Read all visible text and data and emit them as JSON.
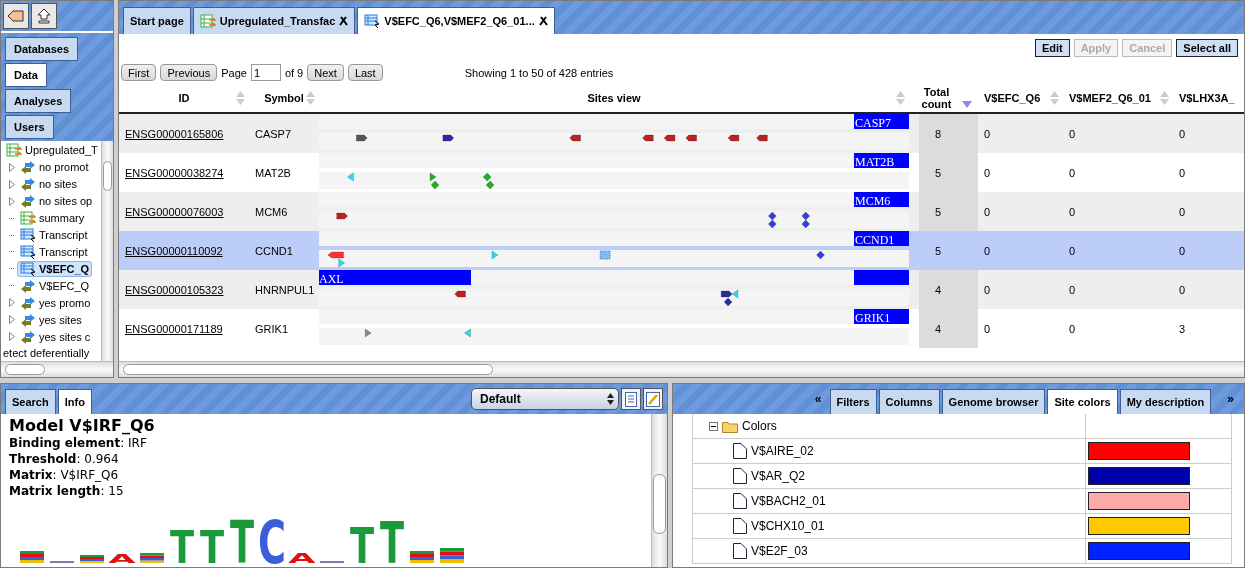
{
  "sidebar": {
    "tabs": [
      {
        "label": "Databases",
        "selected": false
      },
      {
        "label": "Data",
        "selected": true
      },
      {
        "label": "Analyses",
        "selected": false
      },
      {
        "label": "Users",
        "selected": false
      }
    ],
    "tree": [
      {
        "label": "Upregulated_T",
        "kind": "table-green",
        "selected": false,
        "children": [
          {
            "label": "no promot",
            "kind": "arrows",
            "expandable": true,
            "selected": false
          },
          {
            "label": "no sites",
            "kind": "arrows",
            "expandable": true,
            "selected": false
          },
          {
            "label": "no sites op",
            "kind": "arrows",
            "expandable": true,
            "selected": false
          },
          {
            "label": "summary",
            "kind": "table-green",
            "expandable": false,
            "selected": false
          },
          {
            "label": "Transcript",
            "kind": "table-blue",
            "expandable": false,
            "selected": false
          },
          {
            "label": "Transcript",
            "kind": "table-blue",
            "expandable": false,
            "selected": false
          },
          {
            "label": "V$EFC_Q",
            "kind": "table-blue",
            "expandable": false,
            "selected": true
          },
          {
            "label": "V$EFC_Q",
            "kind": "arrows",
            "expandable": false,
            "selected": false
          },
          {
            "label": "yes promo",
            "kind": "arrows",
            "expandable": true,
            "selected": false
          },
          {
            "label": "yes sites",
            "kind": "arrows",
            "expandable": true,
            "selected": false
          },
          {
            "label": "yes sites c",
            "kind": "arrows",
            "expandable": true,
            "selected": false
          }
        ]
      }
    ],
    "footer_text": "etect deferentially"
  },
  "main": {
    "tabs": [
      {
        "label": "Start page",
        "kind": "plain",
        "selected": false,
        "closable": false
      },
      {
        "label": "Upregulated_Transfac",
        "kind": "table-green",
        "selected": false,
        "closable": true
      },
      {
        "label": "V$EFC_Q6,V$MEF2_Q6_01...",
        "kind": "table-blue",
        "selected": true,
        "closable": true
      }
    ],
    "toolbar": [
      {
        "label": "Edit",
        "disabled": false
      },
      {
        "label": "Apply",
        "disabled": true
      },
      {
        "label": "Cancel",
        "disabled": true
      },
      {
        "label": "Select all",
        "disabled": false
      }
    ],
    "pager": {
      "first": "First",
      "previous": "Previous",
      "page_label": "Page",
      "page_value": "1",
      "of": "of 9",
      "next": "Next",
      "last": "Last",
      "summary": "Showing 1 to 50 of 428 entries"
    },
    "table": {
      "columns": [
        {
          "label": "ID",
          "sorted": false
        },
        {
          "label": "Symbol",
          "sorted": false
        },
        {
          "label": "Sites view",
          "sorted": false
        },
        {
          "label": "Total count",
          "sorted": true
        },
        {
          "label": "V$EFC_Q6",
          "sorted": false
        },
        {
          "label": "V$MEF2_Q6_01",
          "sorted": false
        },
        {
          "label": "V$LHX3A_"
        }
      ],
      "rows": [
        {
          "id": "ENSG00000165806",
          "symbol": "CASP7",
          "features": [
            {
              "kind": "gene",
              "text": "CASP7"
            }
          ],
          "total": "8",
          "efc": "0",
          "mef2": "0",
          "lhx3a": "0",
          "selected": false
        },
        {
          "id": "ENSG00000038274",
          "symbol": "MAT2B",
          "features": [
            {
              "kind": "gene",
              "text": "MAT2B"
            }
          ],
          "total": "5",
          "efc": "0",
          "mef2": "0",
          "lhx3a": "0",
          "selected": false
        },
        {
          "id": "ENSG00000076003",
          "symbol": "MCM6",
          "features": [
            {
              "kind": "gene",
              "text": "MCM6"
            }
          ],
          "total": "5",
          "efc": "0",
          "mef2": "0",
          "lhx3a": "0",
          "selected": false
        },
        {
          "id": "ENSG00000110092",
          "symbol": "CCND1",
          "features": [
            {
              "kind": "gene",
              "text": "CCND1"
            }
          ],
          "total": "5",
          "efc": "0",
          "mef2": "0",
          "lhx3a": "0",
          "selected": true
        },
        {
          "id": "ENSG00000105323",
          "symbol": "HNRNPUL1",
          "features": [
            {
              "kind": "upstream",
              "text": "AXL"
            },
            {
              "kind": "gene"
            }
          ],
          "total": "4",
          "efc": "0",
          "mef2": "0",
          "lhx3a": "0",
          "selected": false
        },
        {
          "id": "ENSG00000171189",
          "symbol": "GRIK1",
          "features": [
            {
              "kind": "gene",
              "text": "GRIK1"
            }
          ],
          "total": "4",
          "efc": "0",
          "mef2": "0",
          "lhx3a": "3",
          "selected": false
        }
      ]
    }
  },
  "info_panel": {
    "tabs": [
      {
        "label": "Search",
        "selected": false
      },
      {
        "label": "Info",
        "selected": true
      }
    ],
    "select": {
      "value": "Default"
    },
    "title": "Model V$IRF_Q6",
    "fields": [
      "**Binding element**: IRF",
      "**Threshold**: 0.964",
      "**Matrix**: V$IRF_Q6",
      "**Matrix length**: 15"
    ],
    "logo": [
      {
        "kind": "stack"
      },
      {
        "kind": "bar"
      },
      {
        "kind": "stack"
      },
      {
        "kind": "letter",
        "letter": "A"
      },
      {
        "kind": "stack"
      },
      {
        "kind": "letter",
        "letter": "T"
      },
      {
        "kind": "letter",
        "letter": "T"
      },
      {
        "kind": "letter",
        "letter": "T"
      },
      {
        "kind": "letter",
        "letter": "C"
      },
      {
        "kind": "letter",
        "letter": "A"
      },
      {
        "kind": "bar"
      },
      {
        "kind": "letter",
        "letter": "T"
      },
      {
        "kind": "letter",
        "letter": "T"
      },
      {
        "kind": "stack"
      },
      {
        "kind": "stack"
      }
    ]
  },
  "side_panel": {
    "prev": "«",
    "next": "»",
    "tabs": [
      {
        "label": "Filters",
        "selected": false
      },
      {
        "label": "Columns",
        "selected": false
      },
      {
        "label": "Genome browser",
        "selected": false
      },
      {
        "label": "Site colors",
        "selected": true
      },
      {
        "label": "My description",
        "selected": false
      }
    ],
    "folder": {
      "label": "Colors",
      "expanded": true
    },
    "colors": [
      {
        "label": "V$AIRE_02",
        "color": "#ff0000"
      },
      {
        "label": "V$AR_Q2",
        "color": "#0000aa"
      },
      {
        "label": "V$BACH2_01",
        "color": "#ffaaaa"
      },
      {
        "label": "V$CHX10_01",
        "color": "#ffc800"
      },
      {
        "label": "V$E2F_03",
        "color": "#0022ff"
      }
    ]
  }
}
